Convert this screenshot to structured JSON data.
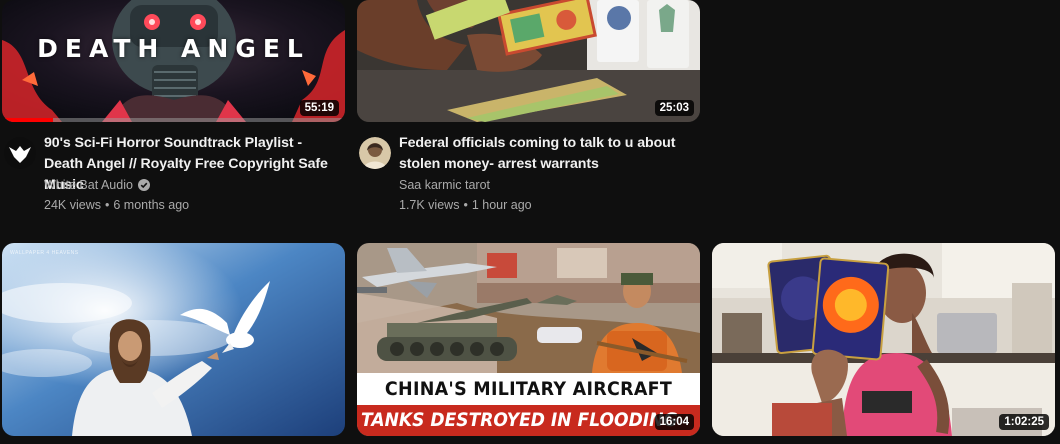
{
  "videos": [
    {
      "thumbnail_text": "DEATH ANGEL",
      "duration": "55:19",
      "watched_fraction": 0.15,
      "title": "90's Sci-Fi Horror Soundtrack Playlist - Death Angel // Royalty Free Copyright Safe Music",
      "channel": "White Bat Audio",
      "verified": true,
      "views": "24K views",
      "age": "6 months ago",
      "separator": "•"
    },
    {
      "duration": "25:03",
      "title": "Federal officials coming to talk to u about stolen money- arrest warrants",
      "channel": "Saa karmic tarot",
      "views": "1.7K views",
      "age": "1 hour ago",
      "separator": "•"
    },
    {
      "thumbnail_small_text": "WALLPAPER 4 HEAVENS",
      "duration": "",
      "title": "",
      "channel": ""
    },
    {
      "thumbnail_text_line1": "CHINA'S MILITARY AIRCRAFT",
      "thumbnail_text_line2": "TANKS DESTROYED IN FLOODING",
      "duration": "16:04"
    },
    {
      "duration": "1:02:25"
    }
  ],
  "colors": {
    "background": "#0f0f0f",
    "title": "#f1f1f1",
    "secondary_text": "#aaaaaa",
    "progress": "#ff0000"
  }
}
